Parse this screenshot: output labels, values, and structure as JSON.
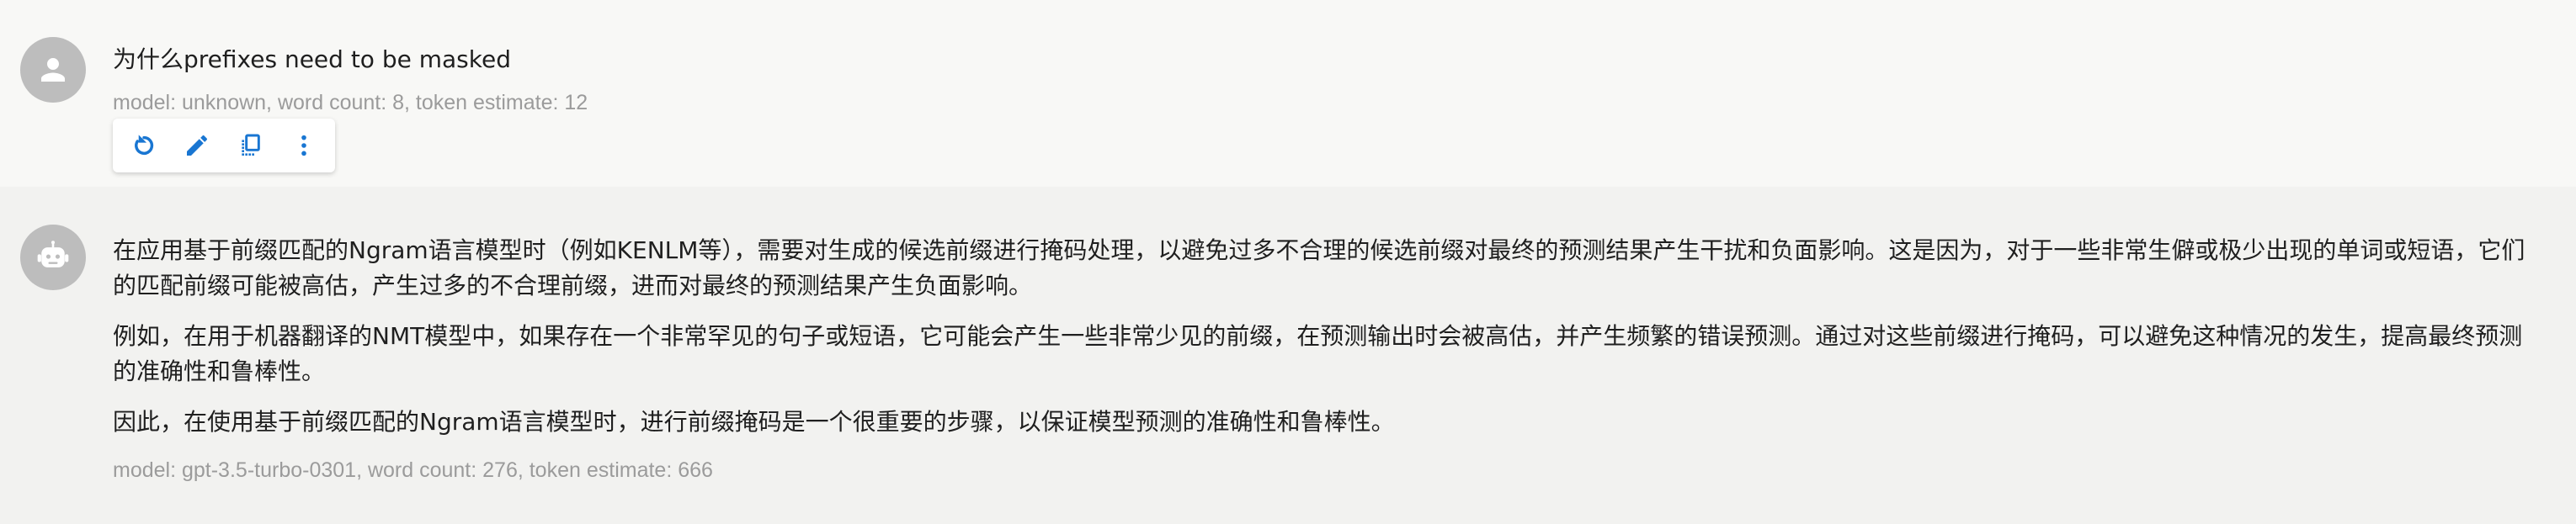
{
  "messages": [
    {
      "role": "user",
      "text": "为什么prefixes need to be masked",
      "meta": "model: unknown, word count: 8, token estimate: 12",
      "actions": [
        {
          "name": "regenerate-icon"
        },
        {
          "name": "edit-icon"
        },
        {
          "name": "copy-icon"
        },
        {
          "name": "more-icon"
        }
      ]
    },
    {
      "role": "assistant",
      "paragraphs": [
        "在应用基于前缀匹配的Ngram语言模型时（例如KENLM等），需要对生成的候选前缀进行掩码处理，以避免过多不合理的候选前缀对最终的预测结果产生干扰和负面影响。这是因为，对于一些非常生僻或极少出现的单词或短语，它们的匹配前缀可能被高估，产生过多的不合理前缀，进而对最终的预测结果产生负面影响。",
        "例如，在用于机器翻译的NMT模型中，如果存在一个非常罕见的句子或短语，它可能会产生一些非常少见的前缀，在预测输出时会被高估，并产生频繁的错误预测。通过对这些前缀进行掩码，可以避免这种情况的发生，提高最终预测的准确性和鲁棒性。",
        "因此，在使用基于前缀匹配的Ngram语言模型时，进行前缀掩码是一个很重要的步骤，以保证模型预测的准确性和鲁棒性。"
      ],
      "meta": "model: gpt-3.5-turbo-0301, word count: 276, token estimate: 666"
    }
  ],
  "colors": {
    "accent": "#1976d2",
    "avatar_bg": "#bdbdbd",
    "meta_text": "#9b9b9b",
    "user_bg": "#f8f8f6",
    "assistant_bg": "#f2f2f0"
  }
}
